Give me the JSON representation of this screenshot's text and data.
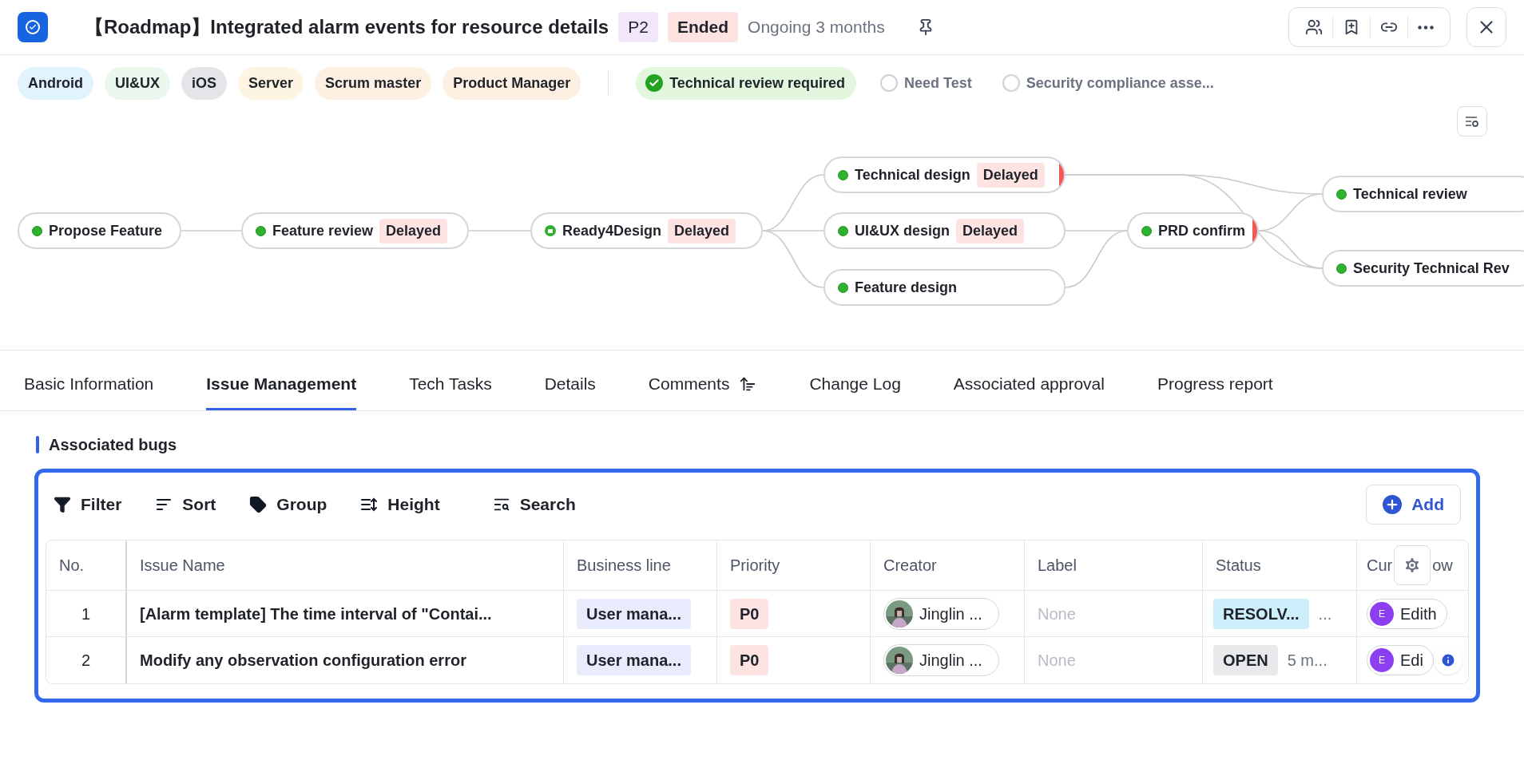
{
  "header": {
    "title": "【Roadmap】Integrated alarm events for resource details",
    "priority": "P2",
    "state": "Ended",
    "duration": "Ongoing 3 months"
  },
  "tags": [
    {
      "label": "Android",
      "color": "#e1f3fc"
    },
    {
      "label": "UI&UX",
      "color": "#ebf7ec"
    },
    {
      "label": "iOS",
      "color": "#e4e5e8"
    },
    {
      "label": "Server",
      "color": "#fdf5e2"
    },
    {
      "label": "Scrum master",
      "color": "#fdefe2"
    },
    {
      "label": "Product Manager",
      "color": "#fdefe2"
    }
  ],
  "checks": [
    {
      "label": "Technical review required",
      "checked": true
    },
    {
      "label": "Need Test",
      "checked": false
    },
    {
      "label": "Security compliance asse...",
      "checked": false
    }
  ],
  "flow": [
    {
      "label": "Propose Feature",
      "kind": "done"
    },
    {
      "label": "Feature review",
      "kind": "done",
      "delayed": "Delayed"
    },
    {
      "label": "Ready4Design",
      "kind": "current",
      "delayed": "Delayed"
    },
    {
      "label": "Technical design",
      "kind": "done",
      "delayed": "Delayed",
      "alert": true
    },
    {
      "label": "UI&UX design",
      "kind": "done",
      "delayed": "Delayed"
    },
    {
      "label": "Feature design",
      "kind": "done"
    },
    {
      "label": "PRD confirm",
      "kind": "done",
      "alert": true
    },
    {
      "label": "Technical review",
      "kind": "done"
    },
    {
      "label": "Security Technical Rev",
      "kind": "done"
    }
  ],
  "tabs": [
    {
      "label": "Basic Information",
      "selected": false
    },
    {
      "label": "Issue Management",
      "selected": true
    },
    {
      "label": "Tech Tasks",
      "selected": false
    },
    {
      "label": "Details",
      "selected": false
    },
    {
      "label": "Comments",
      "selected": false,
      "sort_icon": true
    },
    {
      "label": "Change Log",
      "selected": false
    },
    {
      "label": "Associated approval",
      "selected": false
    },
    {
      "label": "Progress report",
      "selected": false
    }
  ],
  "section_title": "Associated bugs",
  "toolbar": [
    {
      "label": "Filter",
      "kind": "filter"
    },
    {
      "label": "Sort",
      "kind": "sort"
    },
    {
      "label": "Group",
      "kind": "group"
    },
    {
      "label": "Height",
      "kind": "height"
    },
    {
      "label": "Search",
      "kind": "search"
    }
  ],
  "add_button": "Add",
  "table": {
    "columns": [
      "No.",
      "Issue Name",
      "Business line",
      "Priority",
      "Creator",
      "Label",
      "Status"
    ],
    "last_column": {
      "start": "Cur",
      "end": "ow"
    },
    "rows": [
      {
        "no": "1",
        "name": "[Alarm template] The time interval of \"Contai...",
        "business": "User mana...",
        "priority": "P0",
        "creator": "Jinglin ...",
        "label": "None",
        "status": {
          "text": "RESOLV...",
          "kind": "resolved"
        },
        "status_extra": "...",
        "assignee_initial": "E",
        "assignee": "Edith"
      },
      {
        "no": "2",
        "name": "Modify any observation configuration error",
        "business": "User mana...",
        "priority": "P0",
        "creator": "Jinglin ...",
        "label": "None",
        "status": {
          "text": "OPEN",
          "kind": "open"
        },
        "status_extra": "5 m...",
        "assignee_initial": "E",
        "assignee": "Edi"
      }
    ]
  }
}
